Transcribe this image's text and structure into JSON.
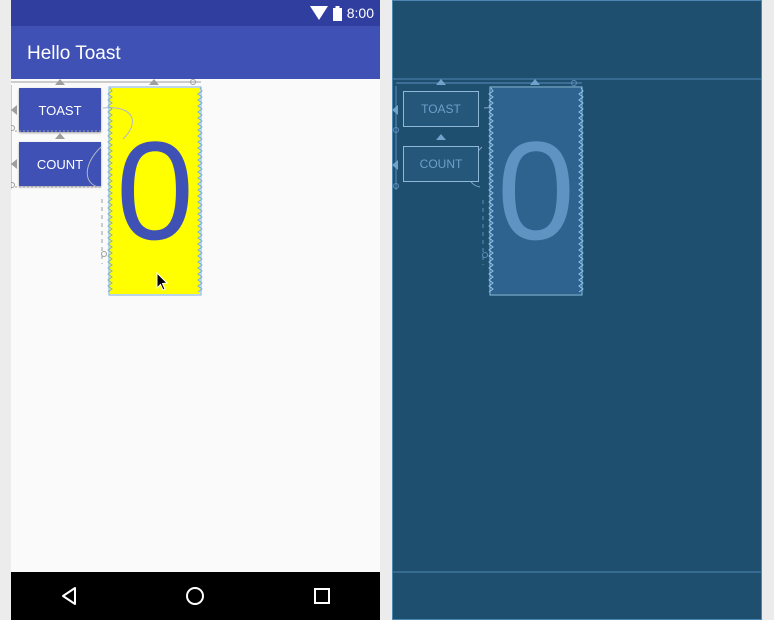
{
  "status_bar": {
    "time": "8:00",
    "wifi_icon": "wifi-icon",
    "battery_icon": "battery-icon"
  },
  "app_bar": {
    "title": "Hello Toast"
  },
  "buttons": {
    "toast_label": "TOAST",
    "count_label": "COUNT"
  },
  "count_display": {
    "value": "0"
  },
  "nav_bar": {
    "back_icon": "back-triangle-icon",
    "home_icon": "home-circle-icon",
    "recents_icon": "recents-square-icon"
  },
  "blueprint": {
    "toast_label": "TOAST",
    "count_label": "COUNT",
    "count_value": "0"
  },
  "colors": {
    "status_bar": "#303f9f",
    "app_bar": "#3f51b5",
    "button": "#3f51b5",
    "count_background": "#ffff00",
    "count_text": "#3f51b5",
    "blueprint_background": "#1f4f6e",
    "blueprint_line": "#6fa3cc"
  }
}
